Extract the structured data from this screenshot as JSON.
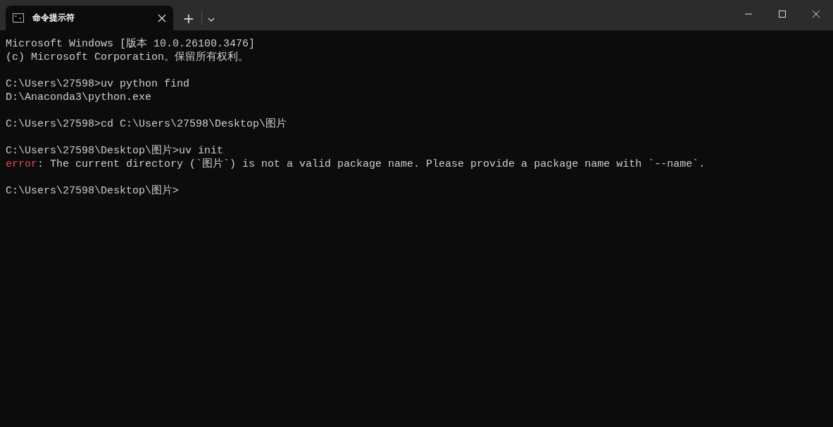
{
  "tabs": [
    {
      "title": "命令提示符",
      "selected": true
    }
  ],
  "new_tab": "+",
  "lines": [
    {
      "kind": "text",
      "text": "Microsoft Windows [版本 10.0.26100.3476]"
    },
    {
      "kind": "text",
      "text": "(c) Microsoft Corporation。保留所有权利。"
    },
    {
      "kind": "blank"
    },
    {
      "kind": "text",
      "text": "C:\\Users\\27598>uv python find"
    },
    {
      "kind": "text",
      "text": "D:\\Anaconda3\\python.exe"
    },
    {
      "kind": "blank"
    },
    {
      "kind": "text",
      "text": "C:\\Users\\27598>cd C:\\Users\\27598\\Desktop\\图片"
    },
    {
      "kind": "blank"
    },
    {
      "kind": "text",
      "text": "C:\\Users\\27598\\Desktop\\图片>uv init"
    },
    {
      "kind": "error",
      "label": "error",
      "text": ": The current directory (`图片`) is not a valid package name. Please provide a package name with `--name`."
    },
    {
      "kind": "blank"
    },
    {
      "kind": "text",
      "text": "C:\\Users\\27598\\Desktop\\图片>"
    }
  ]
}
